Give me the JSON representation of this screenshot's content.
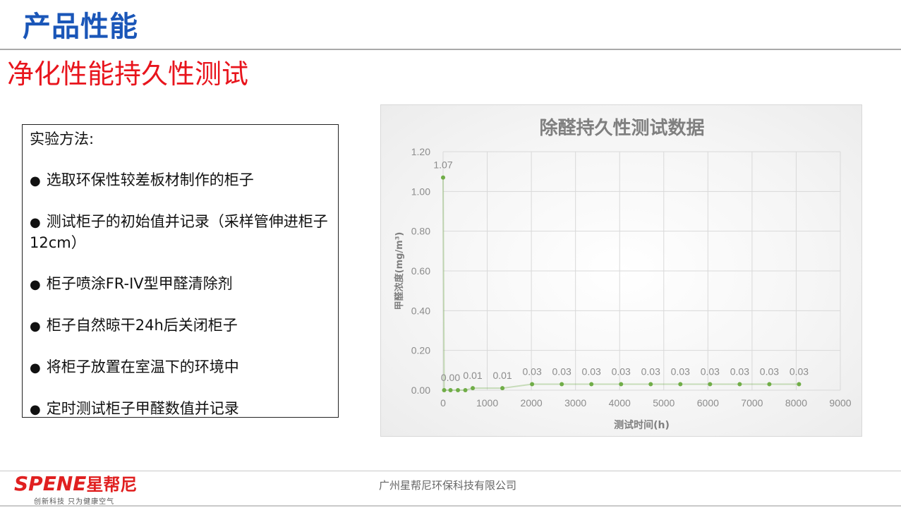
{
  "header": {
    "title": "产品性能",
    "subtitle": "净化性能持久性测试"
  },
  "method": {
    "heading": "实验方法:",
    "items": [
      "选取环保性较差板材制作的柜子",
      "测试柜子的初始值并记录（采样管伸进柜子12cm）",
      "柜子喷涂FR-IV型甲醛清除剂",
      "柜子自然晾干24h后关闭柜子",
      "将柜子放置在室温下的环境中",
      "定时测试柜子甲醛数值并记录"
    ],
    "bullet": "●"
  },
  "chart_data": {
    "type": "line",
    "title": "除醛持久性测试数据",
    "xlabel": "测试时间(h)",
    "ylabel": "甲醛浓度(mg/m³)",
    "xlim": [
      0,
      9000
    ],
    "ylim": [
      0,
      1.2
    ],
    "xticks": [
      0,
      1000,
      2000,
      3000,
      4000,
      5000,
      6000,
      7000,
      8000,
      9000
    ],
    "yticks": [
      "0.00",
      "0.20",
      "0.40",
      "0.60",
      "0.80",
      "1.00",
      "1.20"
    ],
    "grid": true,
    "series_color": "#70ad47",
    "points": [
      {
        "x": 0,
        "y": 1.07,
        "label": "1.07"
      },
      {
        "x": 24,
        "y": 0.0,
        "label": ""
      },
      {
        "x": 168,
        "y": 0.0,
        "label": "0.00"
      },
      {
        "x": 336,
        "y": 0.0,
        "label": ""
      },
      {
        "x": 504,
        "y": 0.0,
        "label": ""
      },
      {
        "x": 672,
        "y": 0.01,
        "label": "0.01"
      },
      {
        "x": 1344,
        "y": 0.01,
        "label": "0.01"
      },
      {
        "x": 2016,
        "y": 0.03,
        "label": "0.03"
      },
      {
        "x": 2688,
        "y": 0.03,
        "label": "0.03"
      },
      {
        "x": 3360,
        "y": 0.03,
        "label": "0.03"
      },
      {
        "x": 4032,
        "y": 0.03,
        "label": "0.03"
      },
      {
        "x": 4704,
        "y": 0.03,
        "label": "0.03"
      },
      {
        "x": 5376,
        "y": 0.03,
        "label": "0.03"
      },
      {
        "x": 6048,
        "y": 0.03,
        "label": "0.03"
      },
      {
        "x": 6720,
        "y": 0.03,
        "label": "0.03"
      },
      {
        "x": 7392,
        "y": 0.03,
        "label": "0.03"
      },
      {
        "x": 8064,
        "y": 0.03,
        "label": "0.03"
      }
    ]
  },
  "footer": {
    "logo_latin": "SPENE",
    "logo_cn": "星帮尼",
    "slogan": "创新科技 只为健康空气",
    "company": "广州星帮尼环保科技有限公司"
  }
}
